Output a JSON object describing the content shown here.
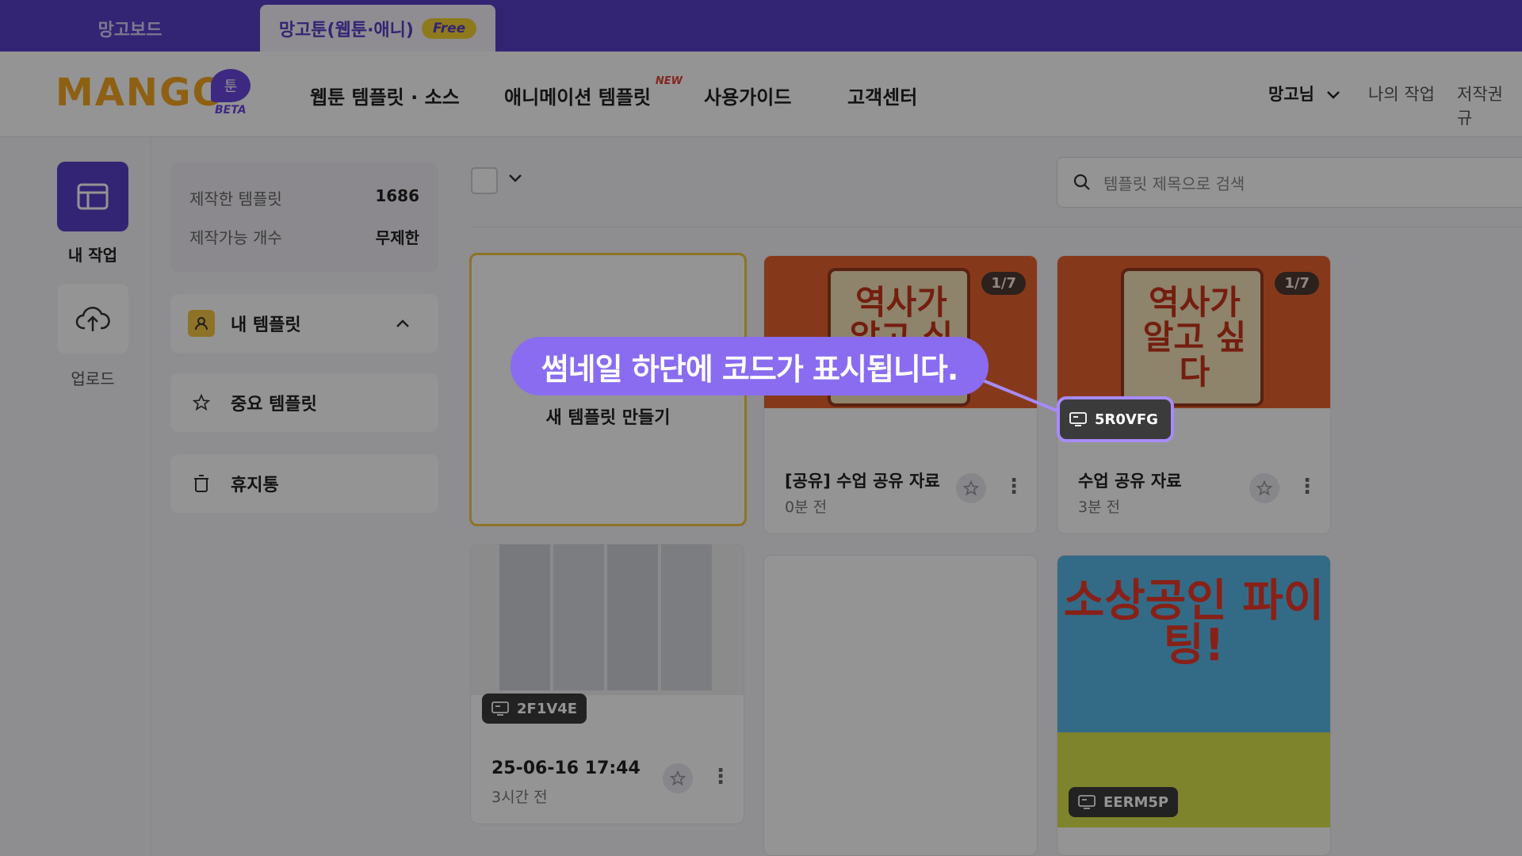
{
  "tabs": {
    "board": "망고보드",
    "toon": "망고툰(웹툰·애니)",
    "free": "Free"
  },
  "logo": {
    "text": "MANGO",
    "bubble": "툰",
    "beta": "BETA"
  },
  "nav": {
    "webtoon": "웹툰 템플릿 · 소스",
    "animation": "애니메이션 템플릿",
    "new": "NEW",
    "guide": "사용가이드",
    "support": "고객센터"
  },
  "header_right": {
    "user": "망고님",
    "mywork": "나의 작업",
    "copyright": "저작권 규"
  },
  "rail": {
    "mywork": "내 작업",
    "upload": "업로드"
  },
  "stats": {
    "made_label": "제작한 템플릿",
    "made_value": "1686",
    "avail_label": "제작가능 개수",
    "avail_value": "무제한"
  },
  "sidebar": {
    "mytemplates": "내 템플릿",
    "important": "중요 템플릿",
    "trash": "휴지통"
  },
  "search": {
    "placeholder": "템플릿 제목으로 검색"
  },
  "new_template": "새 템플릿 만들기",
  "cards": [
    {
      "title": "[공유] 수업 공유 자료",
      "time": "0분 전",
      "pager": "1/7",
      "thumb": "역사가 알고 싶다"
    },
    {
      "title": "수업 공유 자료",
      "time": "3분 전",
      "pager": "1/7",
      "thumb": "역사가 알고 싶다",
      "code": "5R0VFG"
    },
    {
      "title": "25-06-16 17:44",
      "time": "3시간 전",
      "code": "2F1V4E"
    },
    {
      "poster": "소상공인 파이팅!",
      "code": "EERM5P"
    }
  ],
  "tooltip": "썸네일 하단에 코드가 표시됩니다.",
  "colors": {
    "brand": "#5b3fc8",
    "accent": "#f5c542",
    "tooltip": "#8a6cf0"
  }
}
